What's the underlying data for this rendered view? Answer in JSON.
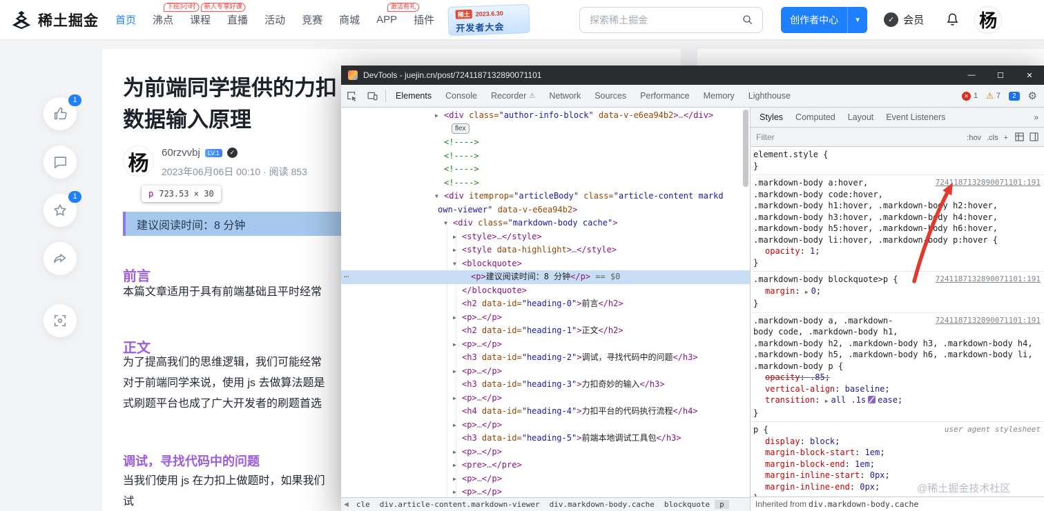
{
  "page": {
    "watermark": "@稀土掘金技术社区"
  },
  "icons": {
    "check-icon": "✓",
    "minimize-icon": "—",
    "maximize-icon": "☐",
    "close-icon": "✕",
    "gear-icon": "⚙",
    "warning-icon": "⚠",
    "overflow-chevrons-icon": "»",
    "dropdown-caret-icon": "▾",
    "crumb-back-icon": "◀",
    "gutter-dots-icon": "⋯",
    "collapsed-arrow-icon": "▶",
    "expanded-arrow-icon": "▼"
  },
  "header": {
    "logo_text": "稀土掘金",
    "nav_items": [
      {
        "label": "首页",
        "active": true
      },
      {
        "label": "沸点",
        "badge": "下班3小时"
      },
      {
        "label": "课程",
        "badge": "新人专享好课"
      },
      {
        "label": "直播"
      },
      {
        "label": "活动"
      },
      {
        "label": "竞赛"
      },
      {
        "label": "商城"
      },
      {
        "label": "APP",
        "badge": "激活有礼"
      },
      {
        "label": "插件"
      }
    ],
    "event_banner": {
      "brand": "稀土",
      "date": "2023.6.30",
      "title": "开发者大会"
    },
    "search_placeholder": "探索稀土掘金",
    "creator_center": "创作者中心",
    "member": "会员",
    "avatar_char": "杨"
  },
  "floating_actions": {
    "like_count": "1",
    "star_count": "1"
  },
  "article": {
    "title_line1": "为前端同学提供的力扣",
    "title_line2": "数据输入原理",
    "author_avatar_char": "杨",
    "author_name": "60rzvvbj",
    "author_level": "LV.1",
    "meta": "2023年06月06日 00:10 · 阅读 853",
    "size_tooltip_tag": "p",
    "size_tooltip_dims": "723.53 × 30",
    "blockquote_text": "建议阅读时间：8 分钟",
    "heading_preface": "前言",
    "p_preface": "本篇文章适用于具有前端基础且平时经常",
    "heading_main": "正文",
    "p_main_lines": [
      "为了提高我们的思维逻辑，我们可能经常",
      "对于前端同学来说，使用 js 去做算法题是",
      "式刷题平台也成了广大开发者的刷题首选"
    ],
    "heading_debug": "调试，寻找代码中的问题",
    "p_debug_lines": [
      "当我们使用 js 在力扣上做题时，如果我们",
      "试"
    ]
  },
  "devtools": {
    "title": "DevTools - juejin.cn/post/7241187132890071101",
    "tabs": [
      "Elements",
      "Console",
      "Recorder",
      "Network",
      "Sources",
      "Performance",
      "Memory",
      "Lighthouse"
    ],
    "active_tab": "Elements",
    "error_count": "1",
    "warning_count": "7",
    "issues_count": "2",
    "elements_tree": [
      {
        "i": 1,
        "a": "r",
        "parts": [
          [
            "t",
            "<div"
          ],
          [
            "a",
            " class="
          ],
          [
            "v",
            "\"author-info-block\""
          ],
          [
            "a",
            " data-v-e6ea94b2"
          ],
          [
            "t",
            ">"
          ],
          [
            "d",
            "…"
          ],
          [
            "t",
            "</div>"
          ]
        ]
      },
      {
        "i": 1,
        "badge": "flex",
        "parts": []
      },
      {
        "i": 1,
        "parts": [
          [
            "c",
            "<!---->"
          ]
        ]
      },
      {
        "i": 1,
        "parts": [
          [
            "c",
            "<!---->"
          ]
        ]
      },
      {
        "i": 1,
        "parts": [
          [
            "c",
            "<!---->"
          ]
        ]
      },
      {
        "i": 1,
        "parts": [
          [
            "c",
            "<!---->"
          ]
        ]
      },
      {
        "i": 1,
        "a": "d",
        "parts": [
          [
            "t",
            "<div"
          ],
          [
            "a",
            " itemprop="
          ],
          [
            "v",
            "\"articleBody\""
          ],
          [
            "a",
            " class="
          ],
          [
            "v",
            "\"article-content markd"
          ]
        ]
      },
      {
        "i": 1,
        "wrap": true,
        "parts": [
          [
            "v",
            "own-viewer\""
          ],
          [
            "a",
            " data-v-e6ea94b2"
          ],
          [
            "t",
            ">"
          ]
        ]
      },
      {
        "i": 2,
        "a": "d",
        "parts": [
          [
            "t",
            "<div"
          ],
          [
            "a",
            " class="
          ],
          [
            "v",
            "\"markdown-body cache\""
          ],
          [
            "t",
            ">"
          ]
        ]
      },
      {
        "i": 3,
        "a": "r",
        "parts": [
          [
            "t",
            "<style>"
          ],
          [
            "d",
            "…"
          ],
          [
            "t",
            "</style>"
          ]
        ]
      },
      {
        "i": 3,
        "a": "r",
        "parts": [
          [
            "t",
            "<style"
          ],
          [
            "a",
            " data-highlight"
          ],
          [
            "t",
            ">"
          ],
          [
            "d",
            "…"
          ],
          [
            "t",
            "</style>"
          ]
        ]
      },
      {
        "i": 3,
        "a": "d",
        "parts": [
          [
            "t",
            "<blockquote>"
          ]
        ]
      },
      {
        "i": 4,
        "sel": true,
        "parts": [
          [
            "t",
            "<p>"
          ],
          [
            "x",
            "建议阅读时间：8 分钟"
          ],
          [
            "t",
            "</p>"
          ],
          [
            "g",
            " == $0"
          ]
        ]
      },
      {
        "i": 3,
        "parts": [
          [
            "t",
            "</blockquote>"
          ]
        ]
      },
      {
        "i": 3,
        "parts": [
          [
            "t",
            "<h2"
          ],
          [
            "a",
            " data-id="
          ],
          [
            "v",
            "\"heading-0\""
          ],
          [
            "t",
            ">"
          ],
          [
            "x",
            "前言"
          ],
          [
            "t",
            "</h2>"
          ]
        ]
      },
      {
        "i": 3,
        "a": "r",
        "parts": [
          [
            "t",
            "<p>"
          ],
          [
            "d",
            "…"
          ],
          [
            "t",
            "</p>"
          ]
        ]
      },
      {
        "i": 3,
        "parts": [
          [
            "t",
            "<h2"
          ],
          [
            "a",
            " data-id="
          ],
          [
            "v",
            "\"heading-1\""
          ],
          [
            "t",
            ">"
          ],
          [
            "x",
            "正文"
          ],
          [
            "t",
            "</h2>"
          ]
        ]
      },
      {
        "i": 3,
        "a": "r",
        "parts": [
          [
            "t",
            "<p>"
          ],
          [
            "d",
            "…"
          ],
          [
            "t",
            "</p>"
          ]
        ]
      },
      {
        "i": 3,
        "parts": [
          [
            "t",
            "<h3"
          ],
          [
            "a",
            " data-id="
          ],
          [
            "v",
            "\"heading-2\""
          ],
          [
            "t",
            ">"
          ],
          [
            "x",
            "调试，寻找代码中的问题"
          ],
          [
            "t",
            "</h3>"
          ]
        ]
      },
      {
        "i": 3,
        "a": "r",
        "parts": [
          [
            "t",
            "<p>"
          ],
          [
            "d",
            "…"
          ],
          [
            "t",
            "</p>"
          ]
        ]
      },
      {
        "i": 3,
        "parts": [
          [
            "t",
            "<h3"
          ],
          [
            "a",
            " data-id="
          ],
          [
            "v",
            "\"heading-3\""
          ],
          [
            "t",
            ">"
          ],
          [
            "x",
            "力扣奇妙的输入"
          ],
          [
            "t",
            "</h3>"
          ]
        ]
      },
      {
        "i": 3,
        "a": "r",
        "parts": [
          [
            "t",
            "<p>"
          ],
          [
            "d",
            "…"
          ],
          [
            "t",
            "</p>"
          ]
        ]
      },
      {
        "i": 3,
        "parts": [
          [
            "t",
            "<h4"
          ],
          [
            "a",
            " data-id="
          ],
          [
            "v",
            "\"heading-4\""
          ],
          [
            "t",
            ">"
          ],
          [
            "x",
            "力扣平台的代码执行流程"
          ],
          [
            "t",
            "</h4>"
          ]
        ]
      },
      {
        "i": 3,
        "a": "r",
        "parts": [
          [
            "t",
            "<p>"
          ],
          [
            "d",
            "…"
          ],
          [
            "t",
            "</p>"
          ]
        ]
      },
      {
        "i": 3,
        "parts": [
          [
            "t",
            "<h3"
          ],
          [
            "a",
            " data-id="
          ],
          [
            "v",
            "\"heading-5\""
          ],
          [
            "t",
            ">"
          ],
          [
            "x",
            "前端本地调试工具包"
          ],
          [
            "t",
            "</h3>"
          ]
        ]
      },
      {
        "i": 3,
        "a": "r",
        "parts": [
          [
            "t",
            "<p>"
          ],
          [
            "d",
            "…"
          ],
          [
            "t",
            "</p>"
          ]
        ]
      },
      {
        "i": 3,
        "a": "r",
        "parts": [
          [
            "t",
            "<pre>"
          ],
          [
            "d",
            "…"
          ],
          [
            "t",
            "</pre>"
          ]
        ]
      },
      {
        "i": 3,
        "a": "r",
        "parts": [
          [
            "t",
            "<p>"
          ],
          [
            "d",
            "…"
          ],
          [
            "t",
            "</p>"
          ]
        ]
      },
      {
        "i": 3,
        "a": "r",
        "parts": [
          [
            "t",
            "<p>"
          ],
          [
            "d",
            "…"
          ],
          [
            "t",
            "</p>"
          ]
        ]
      }
    ],
    "breadcrumbs": [
      "cle",
      "div.article-content.markdown-viewer",
      "div.markdown-body.cache",
      "blockquote",
      "p"
    ],
    "styles": {
      "tabs": [
        "Styles",
        "Computed",
        "Layout",
        "Event Listeners"
      ],
      "active_tab": "Styles",
      "filter_placeholder": "Filter",
      "toggles": [
        ":hov",
        ".cls",
        "+"
      ],
      "rules": [
        {
          "sel": [
            "element.style {"
          ],
          "src": "",
          "ua": false,
          "props": []
        },
        {
          "sel": [
            ".markdown-body a:hover,",
            ".markdown-body code:hover,",
            ".markdown-body h1:hover, .markdown-body h2:hover,",
            ".markdown-body h3:hover, .markdown-body h4:hover,",
            ".markdown-body h5:hover, .markdown-body h6:hover,",
            ".markdown-body li:hover, .markdown-body p:hover {"
          ],
          "src": "7241187132890071101:191",
          "ua": false,
          "props": [
            {
              "n": "opacity",
              "v": "1"
            }
          ]
        },
        {
          "sel": [
            ".markdown-body blockquote>p {"
          ],
          "src": "7241187132890071101:191",
          "ua": false,
          "props": [
            {
              "n": "margin",
              "v": "0",
              "arrow": true
            }
          ]
        },
        {
          "sel": [
            ".markdown-body a, .markdown-",
            "body code, .markdown-body h1,",
            ".markdown-body h2, .markdown-body h3, .markdown-body h4,",
            ".markdown-body h5, .markdown-body h6, .markdown-body li,",
            ".markdown-body p {"
          ],
          "src": "7241187132890071101:191",
          "ua": false,
          "props": [
            {
              "n": "opacity",
              "v": ".85",
              "struck": true
            },
            {
              "n": "vertical-align",
              "v": "baseline"
            },
            {
              "n": "transition",
              "v": "all .1s",
              "v2": "ease",
              "arrow": true,
              "bezier": true
            }
          ]
        },
        {
          "sel": [
            "p {"
          ],
          "src": "user agent stylesheet",
          "ua": true,
          "props": [
            {
              "n": "display",
              "v": "block"
            },
            {
              "n": "margin-block-start",
              "v": "1em"
            },
            {
              "n": "margin-block-end",
              "v": "1em"
            },
            {
              "n": "margin-inline-start",
              "v": "0px"
            },
            {
              "n": "margin-inline-end",
              "v": "0px"
            }
          ]
        }
      ],
      "inherited_prefix": "Inherited from ",
      "inherited_target": "div.markdown-body.cache"
    }
  }
}
